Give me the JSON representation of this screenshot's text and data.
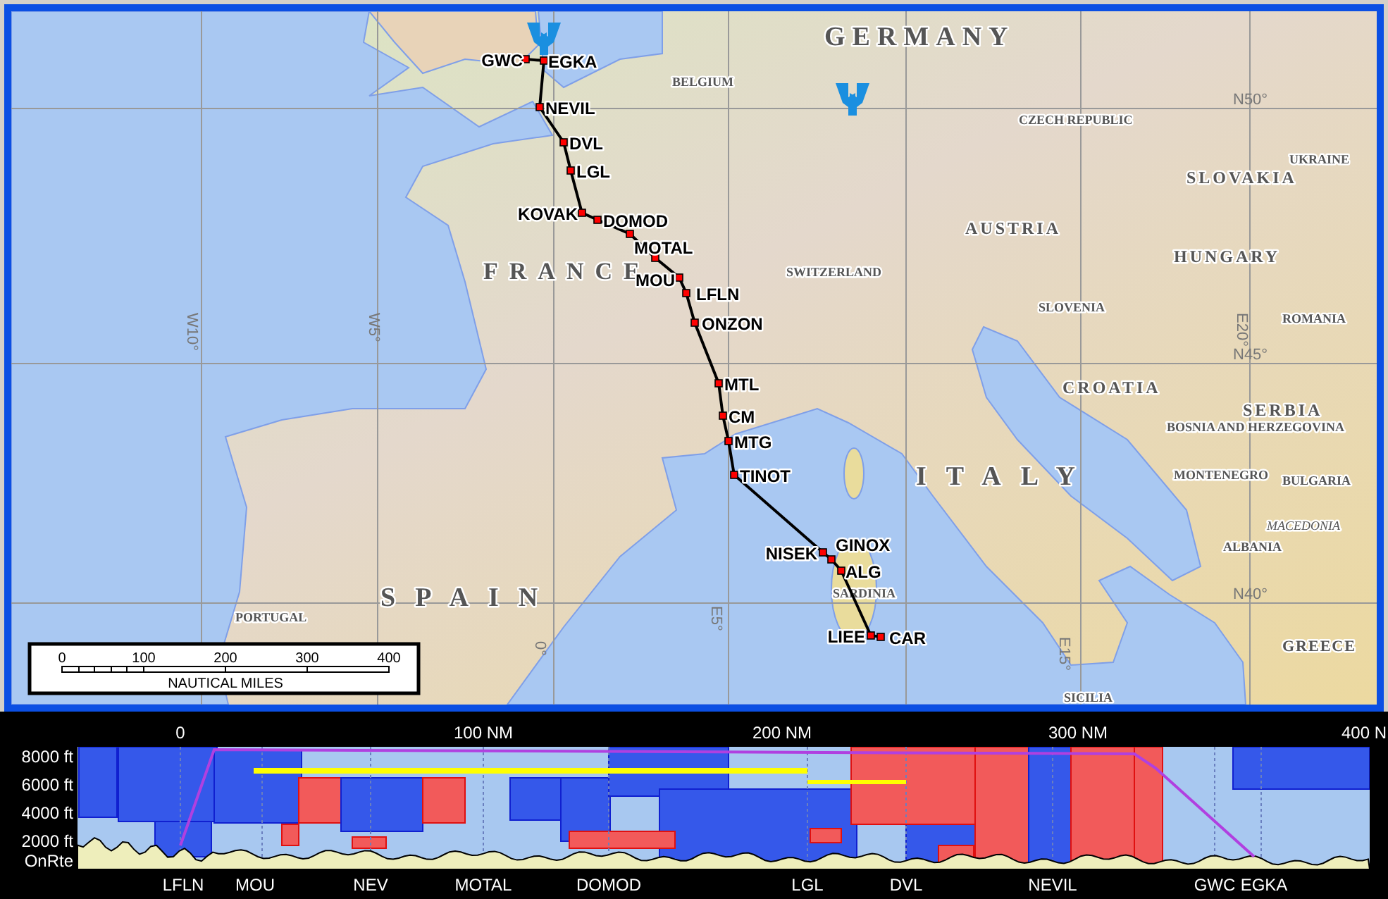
{
  "map": {
    "waypoints": [
      {
        "label": "GWC"
      },
      {
        "label": "EGKA"
      },
      {
        "label": "NEVIL"
      },
      {
        "label": "DVL"
      },
      {
        "label": "LGL"
      },
      {
        "label": "KOVAK"
      },
      {
        "label": "DOMOD"
      },
      {
        "label": "MOTAL"
      },
      {
        "label": "MOU"
      },
      {
        "label": "LFLN"
      },
      {
        "label": "ONZON"
      },
      {
        "label": "MTL"
      },
      {
        "label": "CM"
      },
      {
        "label": "MTG"
      },
      {
        "label": "TINOT"
      },
      {
        "label": "NISEK"
      },
      {
        "label": "GINOX"
      },
      {
        "label": "ALG"
      },
      {
        "label": "LIEE"
      },
      {
        "label": "CAR"
      }
    ],
    "place_labels": [
      {
        "text": "GERMANY",
        "kind": "major"
      },
      {
        "text": "BELGIUM",
        "kind": "minor"
      },
      {
        "text": "CZECH REPUBLIC",
        "kind": "minor"
      },
      {
        "text": "UKRAINE",
        "kind": "minor"
      },
      {
        "text": "SLOVAKIA",
        "kind": "spaced"
      },
      {
        "text": "AUSTRIA",
        "kind": "spaced"
      },
      {
        "text": "HUNGARY",
        "kind": "spaced"
      },
      {
        "text": "FRANCE",
        "kind": "major"
      },
      {
        "text": "SWITZERLAND",
        "kind": "minor"
      },
      {
        "text": "SLOVENIA",
        "kind": "minor"
      },
      {
        "text": "ROMANIA",
        "kind": "minor"
      },
      {
        "text": "CROATIA",
        "kind": "spaced"
      },
      {
        "text": "SERBIA",
        "kind": "spaced"
      },
      {
        "text": "BOSNIA AND HERZEGOVINA",
        "kind": "minor"
      },
      {
        "text": "ITALY",
        "kind": "major"
      },
      {
        "text": "MONTENEGRO",
        "kind": "minor"
      },
      {
        "text": "BULGARIA",
        "kind": "minor"
      },
      {
        "text": "MACEDONIA",
        "kind": "italic"
      },
      {
        "text": "ALBANIA",
        "kind": "minor"
      },
      {
        "text": "SPAIN",
        "kind": "major"
      },
      {
        "text": "PORTUGAL",
        "kind": "minor"
      },
      {
        "text": "SARDINIA",
        "kind": "minor"
      },
      {
        "text": "GREECE",
        "kind": "spaced"
      },
      {
        "text": "SICILIA",
        "kind": "minor"
      }
    ],
    "grid_labels": [
      {
        "text": "N50°",
        "kind": "parallel"
      },
      {
        "text": "N45°",
        "kind": "parallel"
      },
      {
        "text": "N40°",
        "kind": "parallel"
      },
      {
        "text": "E20°",
        "kind": "meridian"
      },
      {
        "text": "E15°",
        "kind": "meridian"
      },
      {
        "text": "W10°",
        "kind": "meridian"
      },
      {
        "text": "W5°",
        "kind": "meridian"
      },
      {
        "text": "E5°",
        "kind": "meridian"
      },
      {
        "text": "0°",
        "kind": "meridian"
      }
    ],
    "scale_bar": {
      "ticks": [
        "0",
        "100",
        "200",
        "300",
        "400"
      ],
      "caption": "NAUTICAL MILES"
    }
  },
  "profile": {
    "distance_labels": [
      "0",
      "100 NM",
      "200 NM",
      "300 NM",
      "400 N"
    ],
    "altitude_labels": [
      "8000 ft",
      "6000 ft",
      "4000 ft",
      "2000 ft",
      "OnRte"
    ],
    "waypoint_labels": [
      "LFLN",
      "MOU",
      "NEV",
      "MOTAL",
      "DOMOD",
      "LGL",
      "DVL",
      "NEVIL",
      "GWC",
      "EGKA"
    ]
  }
}
